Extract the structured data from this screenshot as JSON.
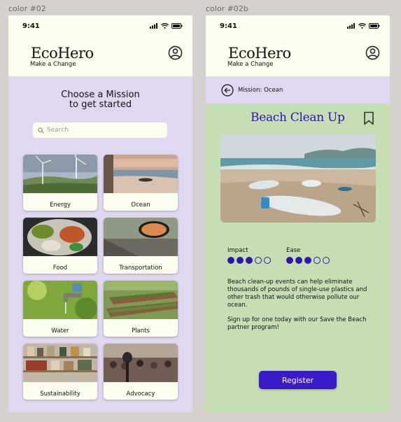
{
  "frames": {
    "left_label": "color #02",
    "right_label": "color #02b"
  },
  "status": {
    "time": "9:41"
  },
  "app": {
    "name": "EcoHero",
    "tagline": "Make a Change"
  },
  "mission_select": {
    "title_line1": "Choose a Mission",
    "title_line2": "to get started",
    "search_placeholder": "Search",
    "categories": [
      {
        "label": "Energy",
        "icon": "wind-turbine-photo"
      },
      {
        "label": "Ocean",
        "icon": "beach-photo"
      },
      {
        "label": "Food",
        "icon": "food-bowl-photo"
      },
      {
        "label": "Transportation",
        "icon": "car-mirror-photo"
      },
      {
        "label": "Water",
        "icon": "faucet-photo"
      },
      {
        "label": "Plants",
        "icon": "garden-photo"
      },
      {
        "label": "Sustainability",
        "icon": "pantry-jars-photo"
      },
      {
        "label": "Advocacy",
        "icon": "microphone-crowd-photo"
      }
    ]
  },
  "mission_detail": {
    "breadcrumb": "Mission: Ocean",
    "title": "Beach Clean Up",
    "impact_label": "Impact",
    "impact_rating": 3,
    "ease_label": "Ease",
    "ease_rating": 3,
    "rating_max": 5,
    "description": "Beach clean-up events can help eliminate thousands of pounds of single-use plastics and other trash that would otherwise pollute our ocean.",
    "cta_text": "Sign up for one today with our Save the Beach partner program!",
    "register_label": "Register"
  },
  "colors": {
    "accent": "#2f17a8",
    "button": "#3b1ac9",
    "lavender": "#e0d7f0",
    "green": "#c5deb4",
    "cream": "#fbfdee"
  }
}
